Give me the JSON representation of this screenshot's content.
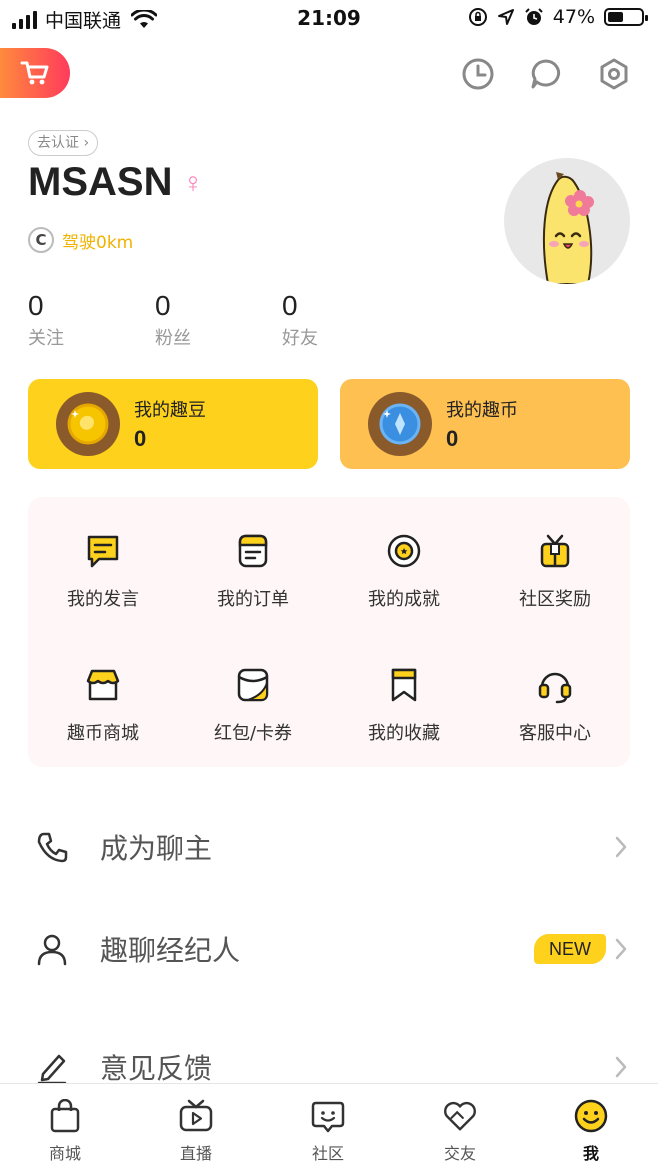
{
  "status_bar": {
    "carrier": "中国联通",
    "time": "21:09",
    "battery_percent": "47%",
    "battery_level": 0.47
  },
  "header": {
    "cart_icon": "cart-icon",
    "icons": [
      "history-clock-icon",
      "message-bubble-icon",
      "settings-hexagon-icon"
    ]
  },
  "profile": {
    "verify_label": "去认证",
    "username": "MSASN",
    "gender_symbol": "♀",
    "drive_label": "驾驶0km",
    "drive_badge": "C",
    "stats": [
      {
        "value": "0",
        "label": "关注"
      },
      {
        "value": "0",
        "label": "粉丝"
      },
      {
        "value": "0",
        "label": "好友"
      }
    ]
  },
  "wallet": [
    {
      "title": "我的趣豆",
      "value": "0",
      "icon": "gold-coin-icon"
    },
    {
      "title": "我的趣币",
      "value": "0",
      "icon": "blue-coin-icon"
    }
  ],
  "grid": [
    {
      "label": "我的发言",
      "icon": "speech-icon"
    },
    {
      "label": "我的订单",
      "icon": "order-icon"
    },
    {
      "label": "我的成就",
      "icon": "achievement-icon"
    },
    {
      "label": "社区奖励",
      "icon": "gift-icon"
    },
    {
      "label": "趣币商城",
      "icon": "shop-icon"
    },
    {
      "label": "红包/卡券",
      "icon": "coupon-icon"
    },
    {
      "label": "我的收藏",
      "icon": "bookmark-icon"
    },
    {
      "label": "客服中心",
      "icon": "headset-icon"
    }
  ],
  "menu": [
    {
      "label": "成为聊主",
      "icon": "phone-icon",
      "badge": ""
    },
    {
      "label": "趣聊经纪人",
      "icon": "person-icon",
      "badge": "NEW"
    },
    {
      "label": "意见反馈",
      "icon": "pen-icon",
      "badge": ""
    }
  ],
  "tabbar": [
    {
      "label": "商城",
      "icon": "bag-icon"
    },
    {
      "label": "直播",
      "icon": "tv-icon"
    },
    {
      "label": "社区",
      "icon": "community-icon"
    },
    {
      "label": "交友",
      "icon": "heart-icon"
    },
    {
      "label": "我",
      "icon": "smile-icon"
    }
  ],
  "colors": {
    "accent_yellow": "#fdd11c",
    "accent_orange": "#ffc052",
    "cart_gradient_start": "#ff8a3d",
    "cart_gradient_end": "#ff3b5c",
    "grid_background": "#fff7f7"
  }
}
